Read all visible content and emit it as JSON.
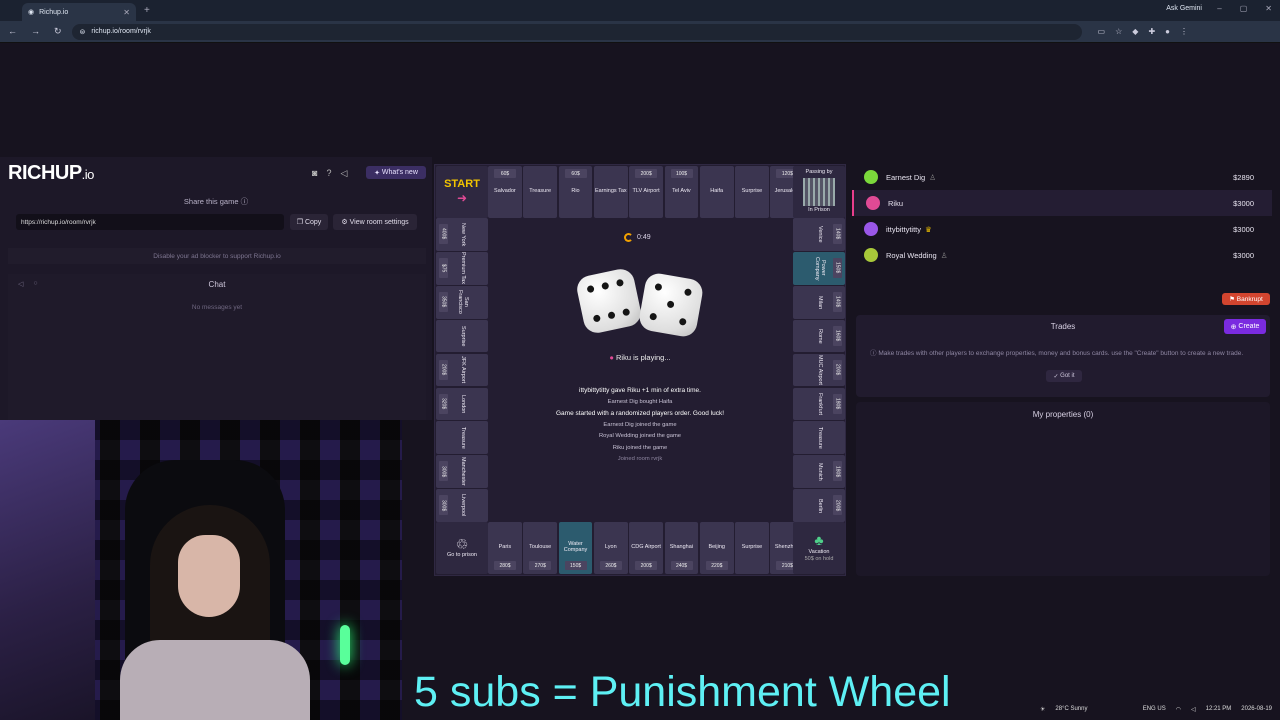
{
  "browser": {
    "tab_title": "Richup.io",
    "url": "richup.io/room/rvrjk",
    "ask_label": "Ask Gemini"
  },
  "site": {
    "logo_main": "RICHUP",
    "logo_io": ".io",
    "whats_new": "What's new",
    "share_title": "Share this game",
    "share_link": "https://richup.io/room/rvrjk",
    "copy": "Copy",
    "room_settings": "View room settings",
    "adblock": "Disable your ad blocker to support Richup.io",
    "chat_title": "Chat",
    "chat_empty": "No messages yet"
  },
  "board": {
    "start": "START",
    "top": [
      {
        "name": "Salvador",
        "price": "60$"
      },
      {
        "name": "Treasure",
        "price": ""
      },
      {
        "name": "Rio",
        "price": "60$"
      },
      {
        "name": "Earnings Tax",
        "price": ""
      },
      {
        "name": "TLV Airport",
        "price": "200$"
      },
      {
        "name": "Tel Aviv",
        "price": "100$"
      },
      {
        "name": "Haifa",
        "price": ""
      },
      {
        "name": "Surprise",
        "price": ""
      },
      {
        "name": "Jerusalem",
        "price": "120$"
      }
    ],
    "prison_corner": "Passing by",
    "in_prison": "In Prison",
    "left": [
      {
        "name": "New York",
        "price": "400$"
      },
      {
        "name": "Premium Tax",
        "price": "$75"
      },
      {
        "name": "San Francisco",
        "price": "350$"
      },
      {
        "name": "Surprise",
        "price": ""
      },
      {
        "name": "JFK Airport",
        "price": "200$"
      },
      {
        "name": "London",
        "price": "320$"
      },
      {
        "name": "Treasure",
        "price": ""
      },
      {
        "name": "Manchester",
        "price": "300$"
      },
      {
        "name": "Liverpool",
        "price": "300$"
      }
    ],
    "right": [
      {
        "name": "Venice",
        "price": "140$"
      },
      {
        "name": "Power Company",
        "price": "150$"
      },
      {
        "name": "Milan",
        "price": "140$"
      },
      {
        "name": "Rome",
        "price": "160$"
      },
      {
        "name": "MUC Airport",
        "price": "200$"
      },
      {
        "name": "Frankfurt",
        "price": "180$"
      },
      {
        "name": "Treasure",
        "price": ""
      },
      {
        "name": "Munich",
        "price": "180$"
      },
      {
        "name": "Berlin",
        "price": "200$"
      }
    ],
    "bottom": [
      {
        "name": "Paris",
        "price": "280$"
      },
      {
        "name": "Toulouse",
        "price": "270$"
      },
      {
        "name": "Water Company",
        "price": "150$"
      },
      {
        "name": "Lyon",
        "price": "260$"
      },
      {
        "name": "CDG Airport",
        "price": "200$"
      },
      {
        "name": "Shanghai",
        "price": "240$"
      },
      {
        "name": "Beijing",
        "price": "220$"
      },
      {
        "name": "Surprise",
        "price": ""
      },
      {
        "name": "Shenzhen",
        "price": "210$"
      }
    ],
    "go_prison": "Go to prison",
    "vacation": "Vacation",
    "vacation_sub": "50$ on hold",
    "timer": "0:49",
    "playing": "Riku  is playing...",
    "log": [
      "ittybittytitty  gave  Riku  +1 min of extra time.",
      "Earnest Dig  bought  Haifa",
      "Game started with a randomized players order. Good luck!",
      "Earnest Dig  joined the game",
      "Royal Wedding  joined the game",
      "Riku  joined the game",
      "Joined room rvrjk"
    ]
  },
  "players": [
    {
      "name": "Earnest Dig",
      "money": "$2890",
      "color": "#7bd83b"
    },
    {
      "name": "Riku",
      "money": "$3000",
      "color": "#e04a95"
    },
    {
      "name": "ittybittytitty",
      "money": "$3000",
      "color": "#9a57e8"
    },
    {
      "name": "Royal Wedding",
      "money": "$3000",
      "color": "#a8c83a"
    }
  ],
  "panel": {
    "bankrupt": "Bankrupt",
    "trades_title": "Trades",
    "create": "Create",
    "trades_info": "Make trades with other players to exchange properties, money and bonus cards. use the \"Create\" button to create a new trade.",
    "got_it": "Got it",
    "my_properties": "My properties (0)"
  },
  "overlay_text": "5 subs = Punishment Wheel",
  "taskbar": {
    "weather": "28°C Sunny",
    "lang": "ENG US",
    "time": "12:21 PM",
    "date": "2026-08-19"
  }
}
